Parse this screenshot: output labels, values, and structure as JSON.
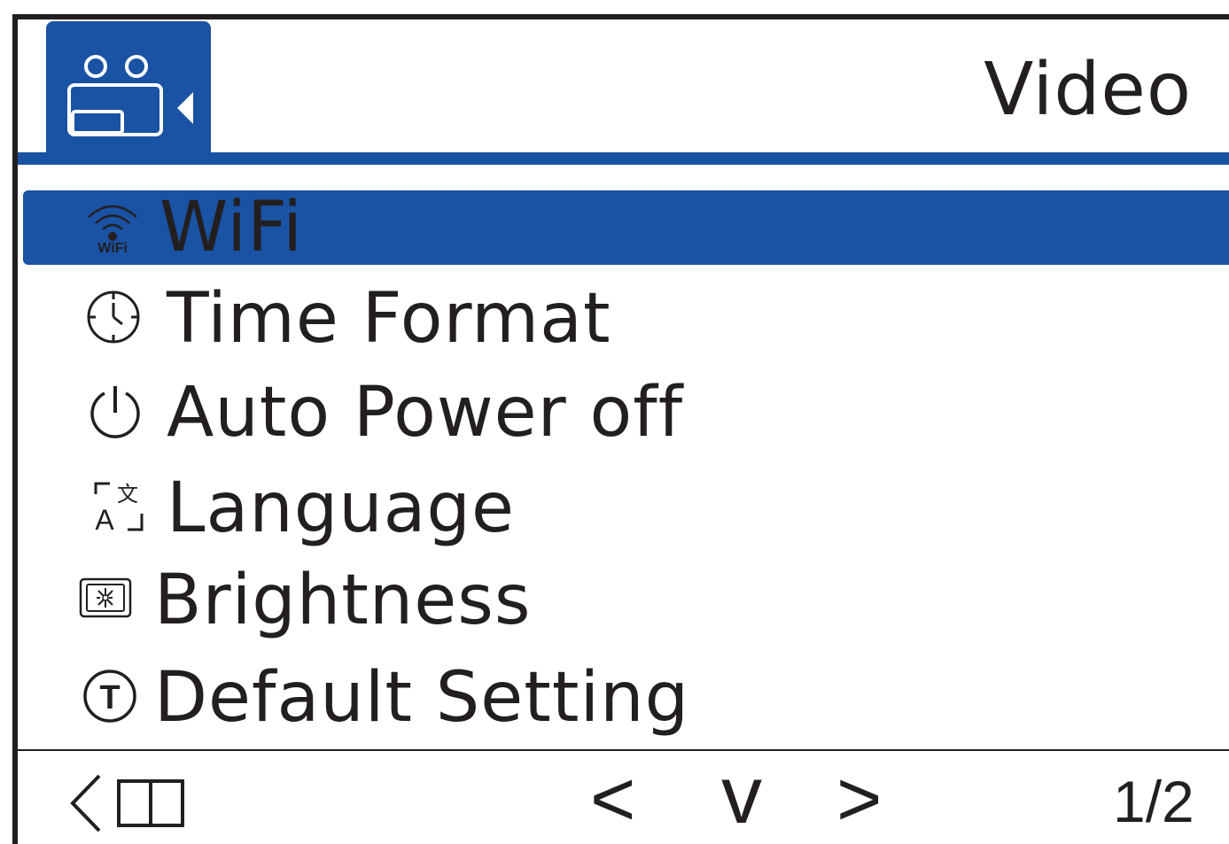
{
  "header": {
    "mode_icon": "video-camera-icon",
    "title": "Video"
  },
  "menu": {
    "page": "1/2",
    "items": [
      {
        "label": "WiFi",
        "icon": "wifi-icon",
        "icon_text": "WiFi",
        "selected": true
      },
      {
        "label": "Time Format",
        "icon": "clock-icon",
        "selected": false
      },
      {
        "label": "Auto Power off",
        "icon": "power-icon",
        "selected": false
      },
      {
        "label": "Language",
        "icon": "language-icon",
        "selected": false
      },
      {
        "label": "Brightness",
        "icon": "brightness-icon",
        "selected": false
      },
      {
        "label": "Default Setting",
        "icon": "default-setting-icon",
        "icon_text": "T",
        "selected": false
      }
    ]
  },
  "footer": {
    "back_icon": "back-icon",
    "prev": "<",
    "down": "v",
    "next": ">",
    "page_indicator": "1/2"
  },
  "colors": {
    "accent": "#1a52a4",
    "text": "#231f20",
    "background": "#ffffff"
  }
}
